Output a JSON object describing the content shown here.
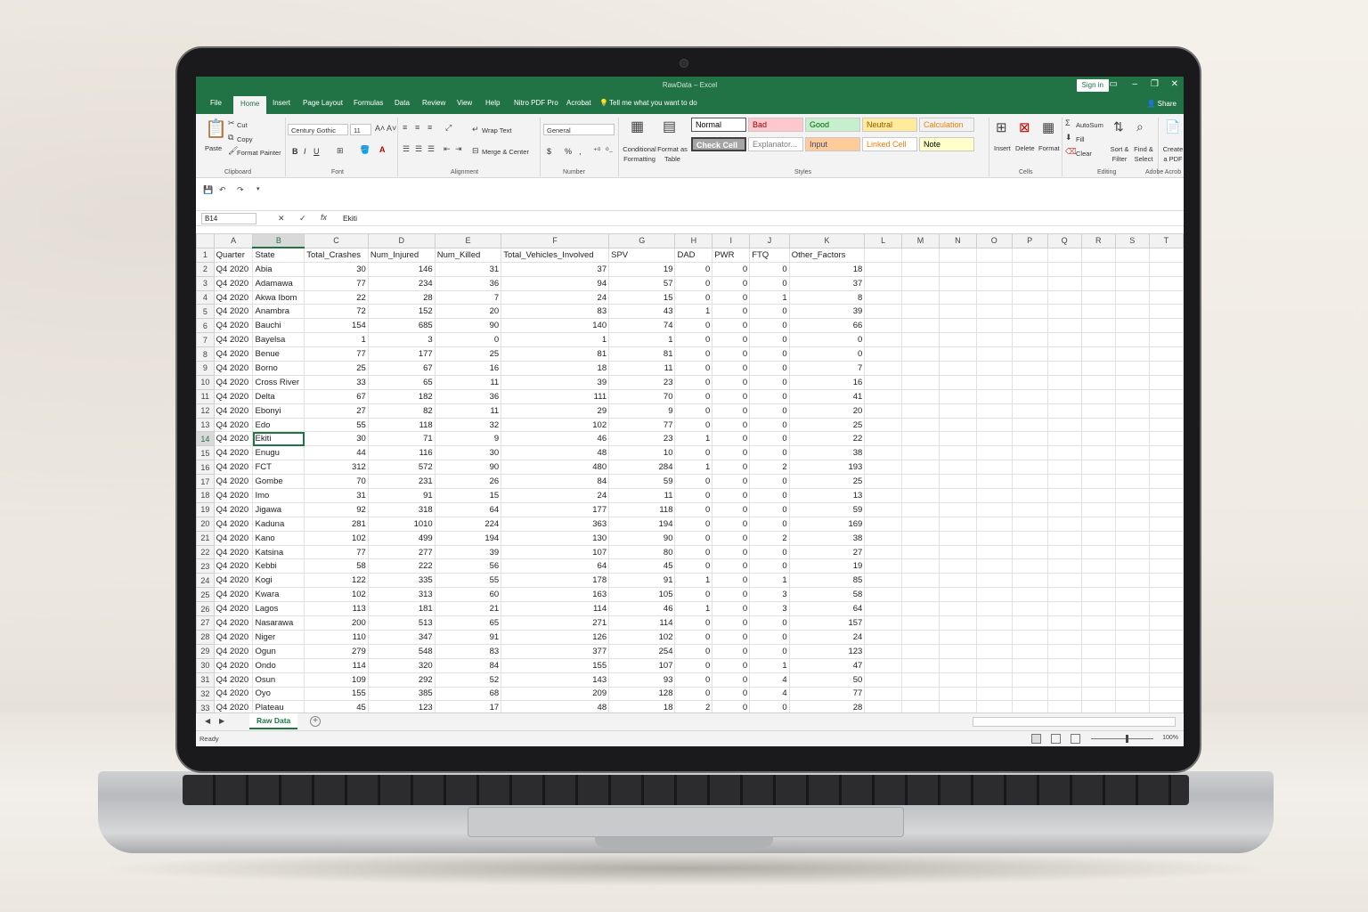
{
  "app": {
    "doc_title": "RawData – Excel",
    "sign_in": "Sign in",
    "share": "Share",
    "tabs": [
      "File",
      "Home",
      "Insert",
      "Page Layout",
      "Formulas",
      "Data",
      "Review",
      "View",
      "Help",
      "Nitro PDF Pro",
      "Acrobat"
    ],
    "tell_me": "Tell me what you want to do"
  },
  "ribbon": {
    "clipboard": {
      "paste": "Paste",
      "cut": "Cut",
      "copy": "Copy",
      "format_painter": "Format Painter",
      "label": "Clipboard"
    },
    "font": {
      "name": "Century Gothic",
      "size": "11",
      "label": "Font",
      "bold": "B",
      "italic": "I",
      "underline": "U"
    },
    "alignment": {
      "wrap": "Wrap Text",
      "merge": "Merge & Center",
      "label": "Alignment"
    },
    "number": {
      "format": "General",
      "currency": "$",
      "percent": "%",
      "comma": ",",
      "label": "Number"
    },
    "styles": {
      "conditional": "Conditional Formatting",
      "format_table": "Format as Table",
      "label": "Styles",
      "cells": [
        {
          "name": "Normal",
          "bg": "#ffffff",
          "fg": "#000000"
        },
        {
          "name": "Bad",
          "bg": "#ffc7ce",
          "fg": "#9c0006"
        },
        {
          "name": "Good",
          "bg": "#c6efce",
          "fg": "#006100"
        },
        {
          "name": "Neutral",
          "bg": "#ffeb9c",
          "fg": "#9c5700"
        },
        {
          "name": "Calculation",
          "bg": "#f2f2f2",
          "fg": "#fa7d00"
        },
        {
          "name": "Check Cell",
          "bg": "#a5a5a5",
          "fg": "#ffffff"
        },
        {
          "name": "Explanator...",
          "bg": "#ffffff",
          "fg": "#7f7f7f"
        },
        {
          "name": "Input",
          "bg": "#ffcc99",
          "fg": "#3f3f76"
        },
        {
          "name": "Linked Cell",
          "bg": "#ffffff",
          "fg": "#fa7d00"
        },
        {
          "name": "Note",
          "bg": "#ffffcc",
          "fg": "#000000"
        }
      ]
    },
    "cells": {
      "insert": "Insert",
      "delete": "Delete",
      "format": "Format",
      "label": "Cells"
    },
    "editing": {
      "autosum": "AutoSum",
      "fill": "Fill",
      "clear": "Clear",
      "sort": "Sort & Filter",
      "find": "Find & Select",
      "label": "Editing"
    },
    "adobe": {
      "create": "Create a PDF",
      "label": "Adobe Acrob"
    }
  },
  "formula_bar": {
    "name_box": "B14",
    "fx": "fx",
    "value": "Ekiti"
  },
  "sheet": {
    "columns": [
      "A",
      "B",
      "C",
      "D",
      "E",
      "F",
      "G",
      "H",
      "I",
      "J",
      "K",
      "L",
      "M",
      "N",
      "O",
      "P",
      "Q",
      "R",
      "S",
      "T"
    ],
    "headers": [
      "Quarter",
      "State",
      "Total_Crashes",
      "Num_Injured",
      "Num_Killed",
      "Total_Vehicles_Involved",
      "SPV",
      "DAD",
      "PWR",
      "FTQ",
      "Other_Factors"
    ],
    "rows": [
      [
        "Q4 2020",
        "Abia",
        "30",
        "146",
        "31",
        "37",
        "19",
        "0",
        "0",
        "0",
        "18"
      ],
      [
        "Q4 2020",
        "Adamawa",
        "77",
        "234",
        "36",
        "94",
        "57",
        "0",
        "0",
        "0",
        "37"
      ],
      [
        "Q4 2020",
        "Akwa Ibom",
        "22",
        "28",
        "7",
        "24",
        "15",
        "0",
        "0",
        "1",
        "8"
      ],
      [
        "Q4 2020",
        "Anambra",
        "72",
        "152",
        "20",
        "83",
        "43",
        "1",
        "0",
        "0",
        "39"
      ],
      [
        "Q4 2020",
        "Bauchi",
        "154",
        "685",
        "90",
        "140",
        "74",
        "0",
        "0",
        "0",
        "66"
      ],
      [
        "Q4 2020",
        "Bayelsa",
        "1",
        "3",
        "0",
        "1",
        "1",
        "0",
        "0",
        "0",
        "0"
      ],
      [
        "Q4 2020",
        "Benue",
        "77",
        "177",
        "25",
        "81",
        "81",
        "0",
        "0",
        "0",
        "0"
      ],
      [
        "Q4 2020",
        "Borno",
        "25",
        "67",
        "16",
        "18",
        "11",
        "0",
        "0",
        "0",
        "7"
      ],
      [
        "Q4 2020",
        "Cross River",
        "33",
        "65",
        "11",
        "39",
        "23",
        "0",
        "0",
        "0",
        "16"
      ],
      [
        "Q4 2020",
        "Delta",
        "67",
        "182",
        "36",
        "111",
        "70",
        "0",
        "0",
        "0",
        "41"
      ],
      [
        "Q4 2020",
        "Ebonyi",
        "27",
        "82",
        "11",
        "29",
        "9",
        "0",
        "0",
        "0",
        "20"
      ],
      [
        "Q4 2020",
        "Edo",
        "55",
        "118",
        "32",
        "102",
        "77",
        "0",
        "0",
        "0",
        "25"
      ],
      [
        "Q4 2020",
        "Ekiti",
        "30",
        "71",
        "9",
        "46",
        "23",
        "1",
        "0",
        "0",
        "22"
      ],
      [
        "Q4 2020",
        "Enugu",
        "44",
        "116",
        "30",
        "48",
        "10",
        "0",
        "0",
        "0",
        "38"
      ],
      [
        "Q4 2020",
        "FCT",
        "312",
        "572",
        "90",
        "480",
        "284",
        "1",
        "0",
        "2",
        "193"
      ],
      [
        "Q4 2020",
        "Gombe",
        "70",
        "231",
        "26",
        "84",
        "59",
        "0",
        "0",
        "0",
        "25"
      ],
      [
        "Q4 2020",
        "Imo",
        "31",
        "91",
        "15",
        "24",
        "11",
        "0",
        "0",
        "0",
        "13"
      ],
      [
        "Q4 2020",
        "Jigawa",
        "92",
        "318",
        "64",
        "177",
        "118",
        "0",
        "0",
        "0",
        "59"
      ],
      [
        "Q4 2020",
        "Kaduna",
        "281",
        "1010",
        "224",
        "363",
        "194",
        "0",
        "0",
        "0",
        "169"
      ],
      [
        "Q4 2020",
        "Kano",
        "102",
        "499",
        "194",
        "130",
        "90",
        "0",
        "0",
        "2",
        "38"
      ],
      [
        "Q4 2020",
        "Katsina",
        "77",
        "277",
        "39",
        "107",
        "80",
        "0",
        "0",
        "0",
        "27"
      ],
      [
        "Q4 2020",
        "Kebbi",
        "58",
        "222",
        "56",
        "64",
        "45",
        "0",
        "0",
        "0",
        "19"
      ],
      [
        "Q4 2020",
        "Kogi",
        "122",
        "335",
        "55",
        "178",
        "91",
        "1",
        "0",
        "1",
        "85"
      ],
      [
        "Q4 2020",
        "Kwara",
        "102",
        "313",
        "60",
        "163",
        "105",
        "0",
        "0",
        "3",
        "58"
      ],
      [
        "Q4 2020",
        "Lagos",
        "113",
        "181",
        "21",
        "114",
        "46",
        "1",
        "0",
        "3",
        "64"
      ],
      [
        "Q4 2020",
        "Nasarawa",
        "200",
        "513",
        "65",
        "271",
        "114",
        "0",
        "0",
        "0",
        "157"
      ],
      [
        "Q4 2020",
        "Niger",
        "110",
        "347",
        "91",
        "126",
        "102",
        "0",
        "0",
        "0",
        "24"
      ],
      [
        "Q4 2020",
        "Ogun",
        "279",
        "548",
        "83",
        "377",
        "254",
        "0",
        "0",
        "0",
        "123"
      ],
      [
        "Q4 2020",
        "Ondo",
        "114",
        "320",
        "84",
        "155",
        "107",
        "0",
        "0",
        "1",
        "47"
      ],
      [
        "Q4 2020",
        "Osun",
        "109",
        "292",
        "52",
        "143",
        "93",
        "0",
        "0",
        "4",
        "50"
      ],
      [
        "Q4 2020",
        "Oyo",
        "155",
        "385",
        "68",
        "209",
        "128",
        "0",
        "0",
        "4",
        "77"
      ],
      [
        "Q4 2020",
        "Plateau",
        "45",
        "123",
        "17",
        "48",
        "18",
        "2",
        "0",
        "0",
        "28"
      ]
    ],
    "selected": {
      "row": 14,
      "col": "B"
    },
    "tab_name": "Raw Data"
  },
  "status": {
    "ready": "Ready",
    "zoom": "100%"
  },
  "colors": {
    "accent": "#217346"
  }
}
